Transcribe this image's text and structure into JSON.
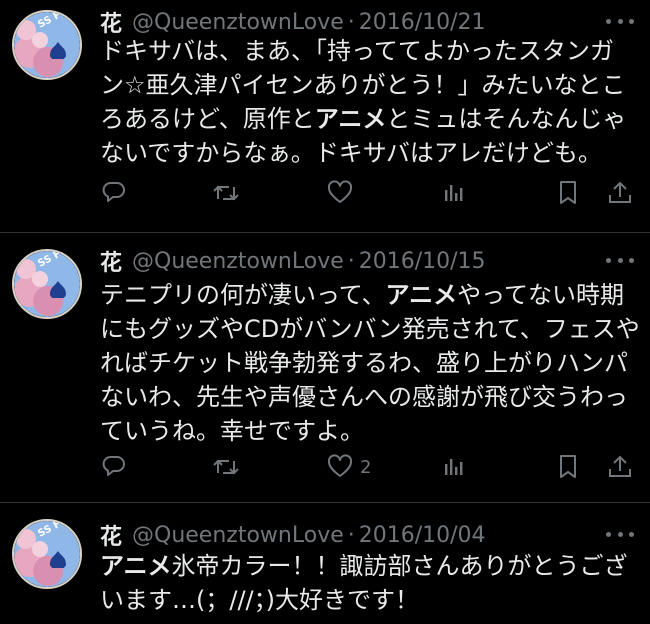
{
  "tweets": [
    {
      "display_name": "花",
      "handle": "@QueenztownLove",
      "separator": "·",
      "date": "2016/10/21",
      "avatar_text": "SS Final",
      "body_lines": [
        [
          "ドキサバは、まあ、「持っててよかったスタンガ"
        ],
        [
          "ン☆亜久津パイセンありがとう！」みたいなとこ"
        ],
        [
          "ろあるけど、原作と",
          {
            "b": "アニメ"
          },
          "とミュはそんなんじゃ"
        ],
        [
          "ないですからなぁ。ドキサバはアレだけども。"
        ]
      ],
      "like_count": ""
    },
    {
      "display_name": "花",
      "handle": "@QueenztownLove",
      "separator": "·",
      "date": "2016/10/15",
      "avatar_text": "SS Final",
      "body_lines": [
        [
          "テニプリの何が凄いって、",
          {
            "b": "アニメ"
          },
          "やってない時期"
        ],
        [
          "にもグッズやCDがバンバン発売されて、フェスや"
        ],
        [
          "ればチケット戦争勃発するわ、盛り上がりハンパ"
        ],
        [
          "ないわ、先生や声優さんへの感謝が飛び交うわっ"
        ],
        [
          "ていうね。幸せですよ。"
        ]
      ],
      "like_count": "2"
    },
    {
      "display_name": "花",
      "handle": "@QueenztownLove",
      "separator": "·",
      "date": "2016/10/04",
      "avatar_text": "SS Final",
      "body_lines": [
        [
          {
            "b": "アニメ"
          },
          "氷帝カラー！！諏訪部さんありがとうござ"
        ],
        [
          "います…(；///；)大好きです！"
        ]
      ],
      "like_count": ""
    }
  ],
  "icons": {
    "reply": "reply-icon",
    "retweet": "retweet-icon",
    "like": "heart-icon",
    "views": "views-icon",
    "bookmark": "bookmark-icon",
    "share": "share-icon",
    "more": "more-icon"
  },
  "colors": {
    "background": "#000000",
    "text": "#e7e9ea",
    "secondary": "#71767b",
    "divider": "#2f3336",
    "avatar_sky": "#8fb7e8",
    "avatar_blossom": "#e8a7c0",
    "avatar_emblem": "#1f3f8f"
  }
}
